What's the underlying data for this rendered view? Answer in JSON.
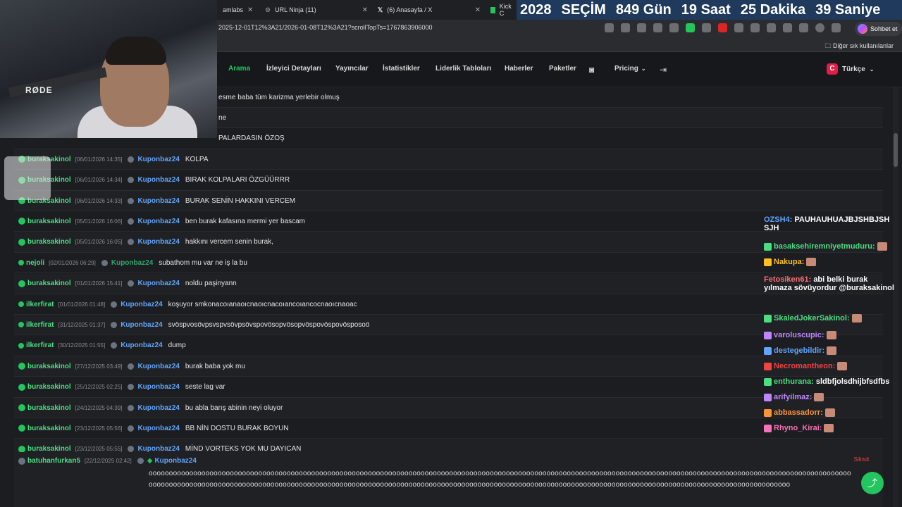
{
  "browser": {
    "tabs": [
      {
        "label": "amlabs"
      },
      {
        "label": "URL Ninja (11)"
      },
      {
        "label": "(6) Anasayfa / X"
      },
      {
        "label": "Kick C"
      }
    ],
    "url": "2025-12-01T12%3A21/2026-01-08T12%3A21?scrollTopTs=1767863906000",
    "sohbet_label": "Sohbet et",
    "bookmark_folder": "Diğer sık kullanılanlar"
  },
  "countdown": {
    "parts": [
      "2028",
      "SEÇİM",
      "849 Gün",
      "19 Saat",
      "25 Dakika",
      "39 Saniye"
    ]
  },
  "nav": {
    "items": [
      "Arama",
      "İzleyici Detayları",
      "Yayıncılar",
      "İstatistikler",
      "Liderlik Tabloları",
      "Haberler",
      "Paketler"
    ],
    "pricing": "Pricing",
    "language": "Türkçe",
    "language_flag": "C"
  },
  "camera": {
    "brand": "RØDE"
  },
  "rows": [
    {
      "user": "",
      "ts": "",
      "channel": "",
      "msg": "esme baba tüm karizma yerlebir olmuş"
    },
    {
      "user": "",
      "ts": "",
      "channel": "",
      "msg": "ne"
    },
    {
      "user": "",
      "ts": "",
      "channel": "",
      "msg": "PALARDASIN ÖZOŞ"
    },
    {
      "user": "buraksakinol",
      "ts": "[06/01/2026 14:35]",
      "channel": "Kuponbaz24",
      "msg": "KOLPA"
    },
    {
      "user": "buraksakinol",
      "ts": "[06/01/2026 14:34]",
      "channel": "Kuponbaz24",
      "msg": "BIRAK KOLPALARI ÖZGÜÜRRR"
    },
    {
      "user": "buraksakinol",
      "ts": "[06/01/2026 14:33]",
      "channel": "Kuponbaz24",
      "msg": "BURAK SENİN HAKKINI VERCEM"
    },
    {
      "user": "buraksakinol",
      "ts": "[05/01/2026 16:06]",
      "channel": "Kuponbaz24",
      "msg": "ben burak kafasına mermi yer bascam"
    },
    {
      "user": "buraksakinol",
      "ts": "[05/01/2026 16:05]",
      "channel": "Kuponbaz24",
      "msg": "hakkını vercem senin burak,"
    },
    {
      "user": "nejoli",
      "ts": "[02/01/2026 06:29]",
      "channel": "Kuponbaz24",
      "msg": "subathom mu var ne iş la bu"
    },
    {
      "user": "buraksakinol",
      "ts": "[01/01/2026 15:41]",
      "channel": "Kuponbaz24",
      "msg": "noldu paşinyann"
    },
    {
      "user": "ilkerfirat",
      "ts": "[01/01/2026 01:48]",
      "channel": "Kuponbaz24",
      "msg": "koşuyor smkonacoıanaoıcnaoıcnacoıancoıancocnaoıcnaoac"
    },
    {
      "user": "ilkerfirat",
      "ts": "[31/12/2025 01:37]",
      "channel": "Kuponbaz24",
      "msg": "svöspvosövpsvspvsövpsövspovösopvösopvöspovöspovösposoö"
    },
    {
      "user": "ilkerfirat",
      "ts": "[30/12/2025 01:55]",
      "channel": "Kuponbaz24",
      "msg": "dump"
    },
    {
      "user": "buraksakinol",
      "ts": "[27/12/2025 03:49]",
      "channel": "Kuponbaz24",
      "msg": "burak baba yok mu"
    },
    {
      "user": "buraksakinol",
      "ts": "[25/12/2025 02:25]",
      "channel": "Kuponbaz24",
      "msg": "seste lag var"
    },
    {
      "user": "buraksakinol",
      "ts": "[24/12/2025 04:39]",
      "channel": "Kuponbaz24",
      "msg": "bu abla barış abinin neyi oluyor"
    },
    {
      "user": "buraksakinol",
      "ts": "[23/12/2025 05:56]",
      "channel": "Kuponbaz24",
      "msg": "BB NİN DOSTU BURAK BOYUN"
    },
    {
      "user": "buraksakinol",
      "ts": "[23/12/2025 05:55]",
      "channel": "Kuponbaz24",
      "msg": "MİND VORTEKS YOK MU DAYICAN"
    }
  ],
  "last_row": {
    "user": "batuhanfurkan5",
    "ts": "[22/12/2025 02:42]",
    "channel": "Kuponbaz24",
    "deleted": "Silindi",
    "msg": "ooooooooooooooooooooooooooooooooooooooooooooooooooooooooooooooooooooooooooooooooooooooooooooooooooooooooooooooooooooooooooooooooooooooooooooooooooooooooooooooooooooooooooooooooooooooooooooooooooooooooooooooooooooooooooooooooooooooooooooooooooooooooooooooooooooooooooooooooooooooooooooooooooooooooooooooooooooooooooooooooooooooooooo"
  },
  "live_chat": [
    {
      "name": "OZSH4:",
      "text": "PAUHAUHUAJBJSHBJSH SJH",
      "color": "#60a5fa"
    },
    {
      "name": "basaksehiremniyetmuduru:",
      "text": "",
      "color": "#4ade80"
    },
    {
      "name": "Nakupa:",
      "text": "",
      "color": "#fbbf24"
    },
    {
      "name": "Fetosiken61:",
      "text": "abi belki burak yılmaza sövüyordur @buraksakinol",
      "color": "#f87171"
    },
    {
      "name": "SkaledJokerSakinol:",
      "text": "",
      "color": "#4ade80"
    },
    {
      "name": "varoluscupic:",
      "text": "",
      "color": "#c084fc"
    },
    {
      "name": "destegebildir:",
      "text": "",
      "color": "#60a5fa"
    },
    {
      "name": "Necromantheon:",
      "text": "",
      "color": "#ef4444"
    },
    {
      "name": "enthurana:",
      "text": "sldbfjolsdhijbfsdfbs",
      "color": "#4ade80"
    },
    {
      "name": "arifyilmaz:",
      "text": "",
      "color": "#c084fc"
    },
    {
      "name": "abbassadorr:",
      "text": "",
      "color": "#fb923c"
    },
    {
      "name": "Rhyno_Kirai:",
      "text": "",
      "color": "#f472b6"
    }
  ]
}
